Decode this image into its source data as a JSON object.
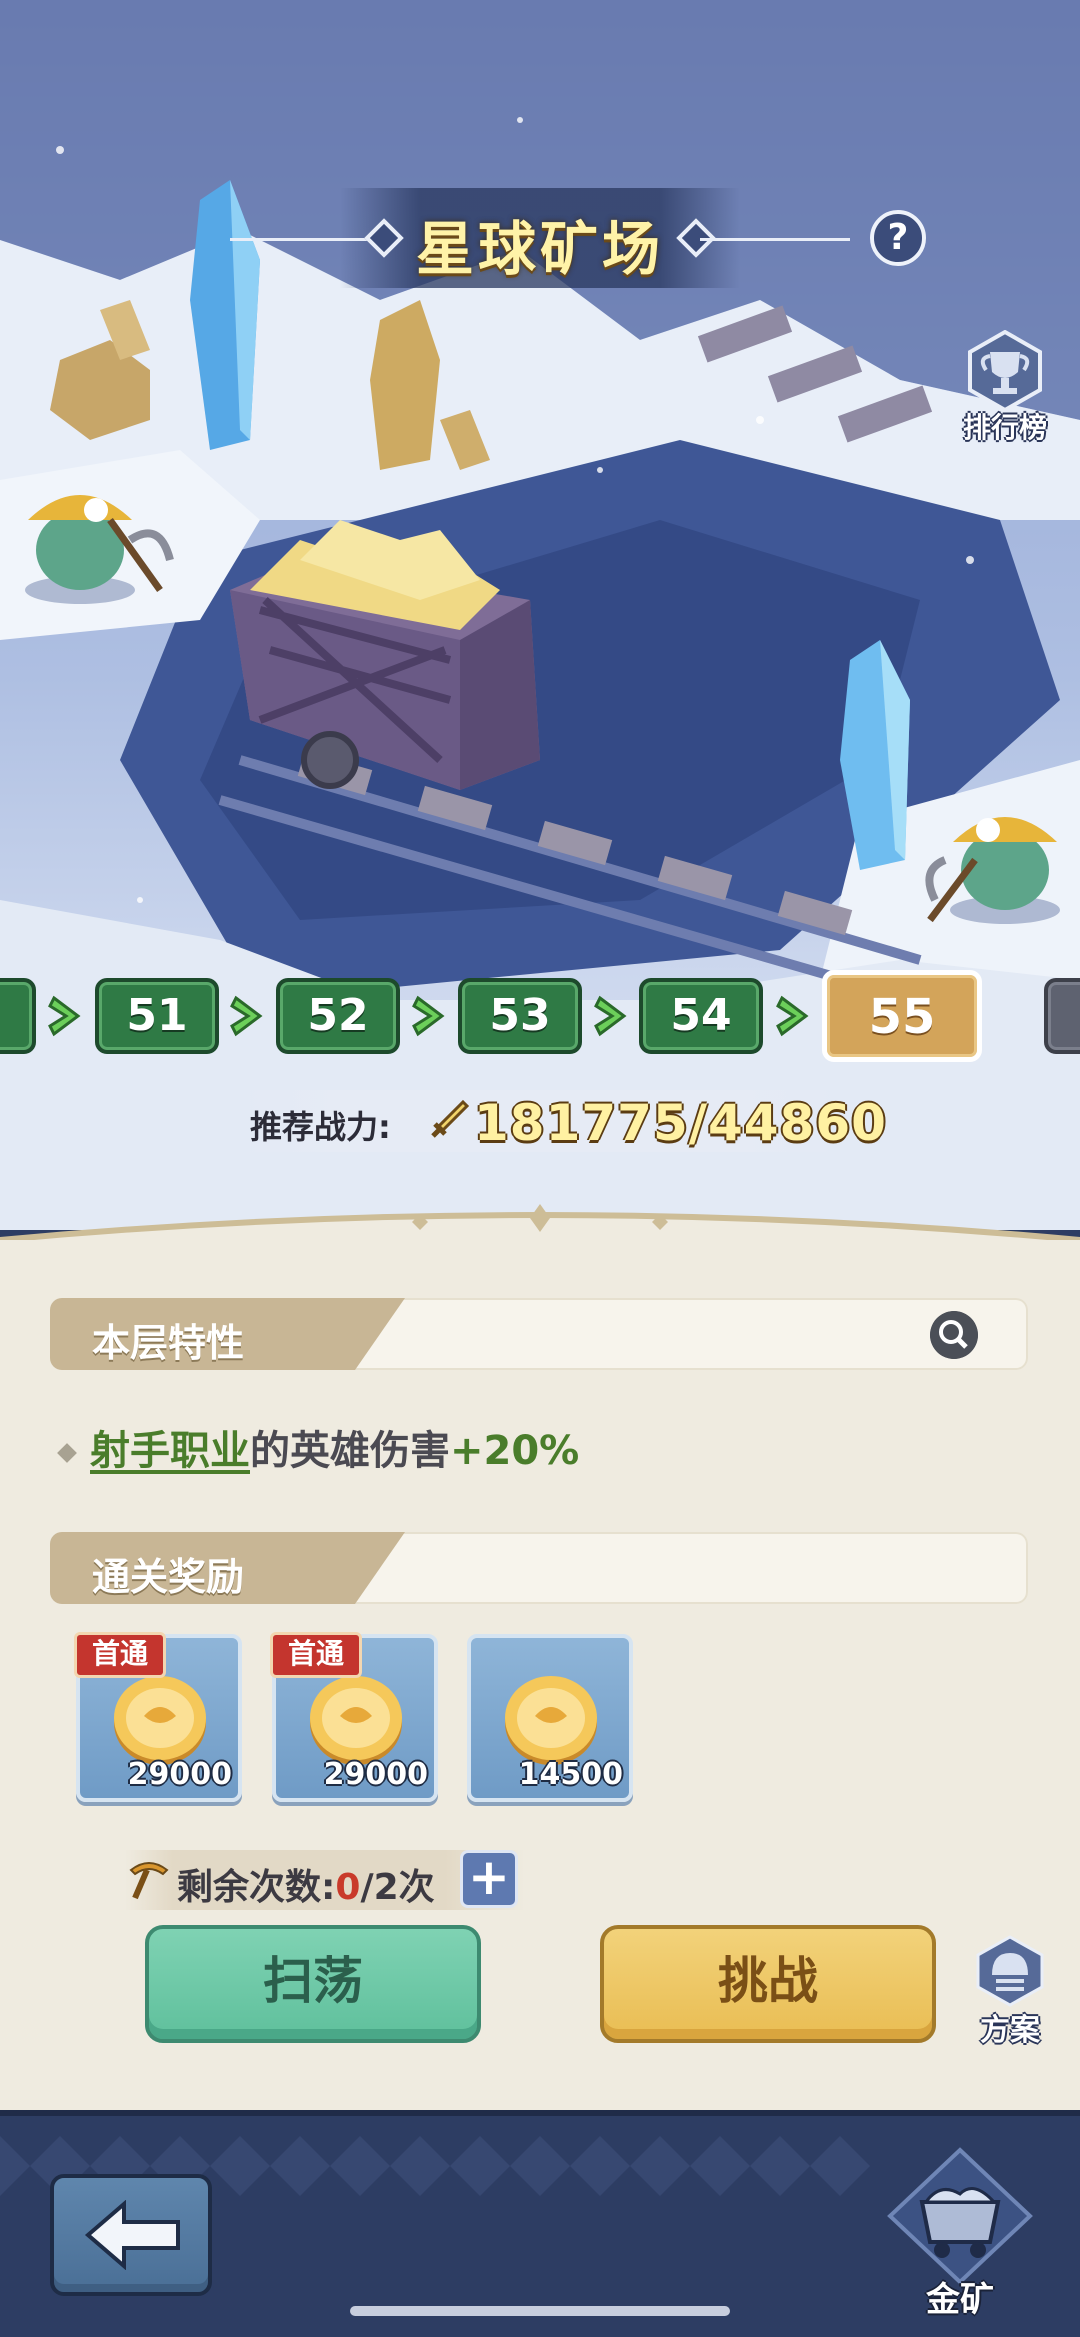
{
  "header": {
    "title": "星球矿场"
  },
  "help": {
    "symbol": "?"
  },
  "leaderboard": {
    "label": "排行榜"
  },
  "levels": {
    "visible": [
      "51",
      "52",
      "53",
      "54",
      "55"
    ],
    "current": "55"
  },
  "recommended_power": {
    "label": "推荐战力:",
    "value": "181775/44860"
  },
  "floor_traits": {
    "title": "本层特性",
    "trait": {
      "link_text": "射手职业",
      "middle_text": "的英雄伤害",
      "bonus_text": "+20%"
    }
  },
  "clear_rewards": {
    "title": "通关奖励",
    "items": [
      {
        "badge": "首通",
        "quantity": "29000",
        "icon": "gold-coin-icon"
      },
      {
        "badge": "首通",
        "quantity": "29000",
        "icon": "gold-coin-icon"
      },
      {
        "badge": "",
        "quantity": "14500",
        "icon": "gold-coin-icon"
      }
    ]
  },
  "attempts": {
    "label": "剩余次数:",
    "used": "0",
    "suffix": "/2次",
    "plus": "+"
  },
  "buttons": {
    "sweep": "扫荡",
    "challenge": "挑战",
    "plan": "方案"
  },
  "footer": {
    "gold_mine_label": "金矿",
    "back_icon": "back-arrow-icon"
  },
  "colors": {
    "level_done": "#2f7a45",
    "level_current": "#d3a45a",
    "sweep": "#5fc09c",
    "challenge": "#e9bd53",
    "bonus_green": "#4a7d2b",
    "zero_red": "#c93a2a"
  }
}
